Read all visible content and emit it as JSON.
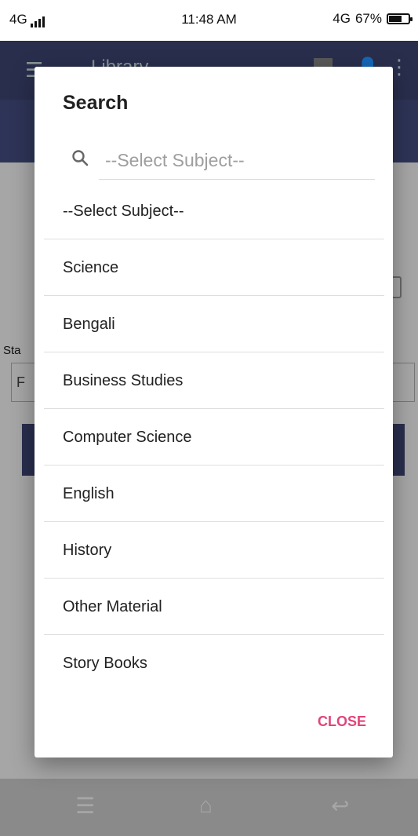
{
  "status_bar": {
    "network_left": "4G",
    "time": "11:48 AM",
    "network_right": "4G",
    "battery": "67%",
    "battery_level": 0.67
  },
  "app": {
    "title": "Library",
    "background_label": "Sta",
    "background_field_initial": "F"
  },
  "dialog": {
    "title": "Search",
    "search_placeholder": "--Select Subject--",
    "items": [
      "--Select Subject--",
      "Science",
      "Bengali",
      "Business Studies",
      "Computer Science",
      "English",
      "History",
      "Other Material",
      "Story Books"
    ],
    "close_label": "CLOSE"
  },
  "colors": {
    "accent": "#e0457b",
    "appbar": "#2f3558"
  },
  "icons": [
    "search-icon",
    "menu-icon",
    "calendar-icon",
    "avatar-icon",
    "more-vert-icon",
    "home-icon",
    "back-icon"
  ]
}
